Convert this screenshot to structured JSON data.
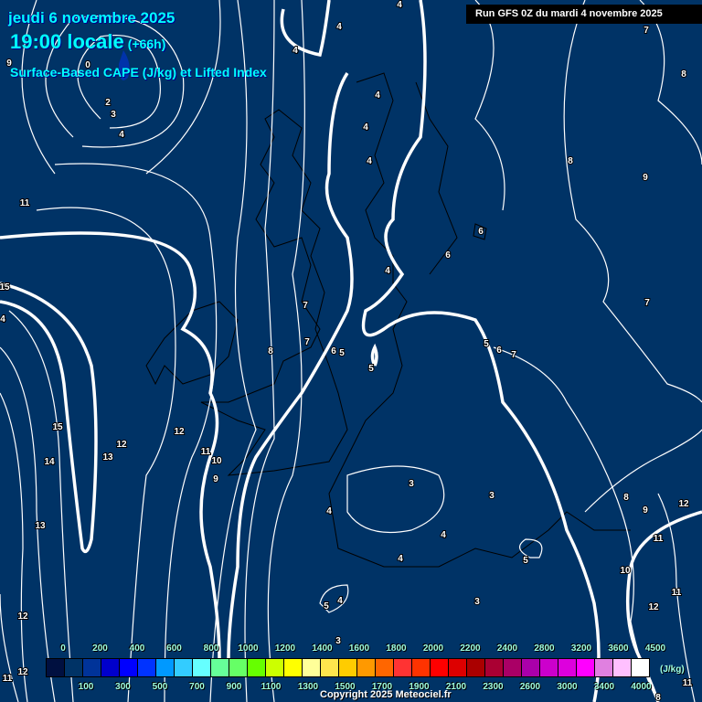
{
  "header": {
    "date": "jeudi 6 novembre 2025",
    "time": "19:00 locale",
    "lead": "(+66h)",
    "parameter": "Surface-Based CAPE (J/kg) et Lifted Index",
    "run": "Run GFS 0Z du mardi 4 novembre 2025"
  },
  "legend": {
    "unit": "(J/kg)",
    "colors": [
      "#001040",
      "#003366",
      "#003399",
      "#0000cc",
      "#0000ff",
      "#0033ff",
      "#0099ff",
      "#33ccff",
      "#66ffff",
      "#66ff99",
      "#66ff66",
      "#66ff00",
      "#ccff00",
      "#ffff00",
      "#ffff99",
      "#ffe64d",
      "#ffcc00",
      "#ff9900",
      "#ff6600",
      "#ff3333",
      "#ff3300",
      "#ff0000",
      "#dd0000",
      "#aa0000",
      "#aa0033",
      "#aa0066",
      "#aa00aa",
      "#cc00cc",
      "#dd00dd",
      "#ff00ff",
      "#e080e0",
      "#ffc0ff",
      "#ffffff"
    ],
    "top_labels": [
      "0",
      "200",
      "400",
      "600",
      "800",
      "1000",
      "1200",
      "1400",
      "1600",
      "1800",
      "2000",
      "2200",
      "2400",
      "2800",
      "3200",
      "3600",
      "4500"
    ],
    "bottom_labels": [
      "100",
      "300",
      "500",
      "700",
      "900",
      "1100",
      "1300",
      "1500",
      "1700",
      "1900",
      "2100",
      "2300",
      "2600",
      "3000",
      "3400",
      "4000"
    ]
  },
  "copyright": "Copyright 2025 Meteociel.fr",
  "contour_labels": [
    "4",
    "4",
    "7",
    "4",
    "8",
    "2",
    "3",
    "4",
    "4",
    "4",
    "4",
    "8",
    "9",
    "11",
    "6",
    "6",
    "4",
    "15",
    "7",
    "7",
    "4",
    "7",
    "8",
    "6",
    "5",
    "5",
    "6",
    "7",
    "5",
    "12",
    "15",
    "13",
    "12",
    "11",
    "10",
    "14",
    "9",
    "3",
    "3",
    "8",
    "9",
    "12",
    "4",
    "13",
    "4",
    "11",
    "5",
    "4",
    "10",
    "11",
    "12",
    "5",
    "4",
    "3",
    "12",
    "3",
    "12",
    "11",
    "11",
    "8",
    "9",
    "0"
  ]
}
